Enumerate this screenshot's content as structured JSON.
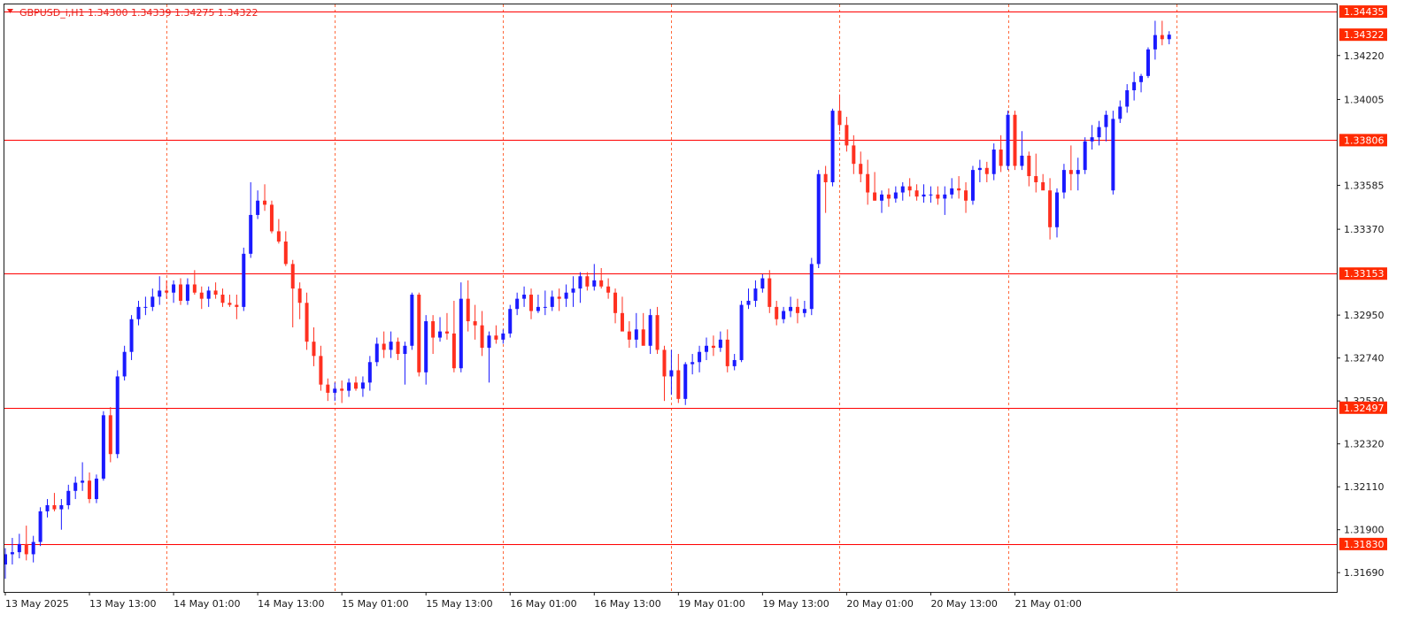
{
  "header": {
    "symbol": "GBPUSD_i",
    "timeframe": "H1",
    "open": "1.34300",
    "high": "1.34339",
    "low": "1.34275",
    "close": "1.34322",
    "label": "GBPUSD_i,H1  1.34300 1.34339 1.34275 1.34322"
  },
  "colors": {
    "bull": "#1a1aff",
    "bear": "#ff3020",
    "level_line": "#ff0000",
    "grid": "#ff6a3d",
    "axis": "#1a1a1a",
    "tag_bg": "#ff2a00",
    "background": "#ffffff"
  },
  "chart_data": {
    "type": "candlestick",
    "ylim": [
      1.316,
      1.3447
    ],
    "y_ticks": [
      "1.34220",
      "1.34005",
      "1.33585",
      "1.33370",
      "1.32950",
      "1.32740",
      "1.32530",
      "1.32320",
      "1.32110",
      "1.31900",
      "1.31690"
    ],
    "x_ticks": [
      "13 May 2025",
      "13 May 13:00",
      "14 May 01:00",
      "14 May 13:00",
      "15 May 01:00",
      "15 May 13:00",
      "16 May 01:00",
      "16 May 13:00",
      "19 May 01:00",
      "19 May 13:00",
      "20 May 01:00",
      "20 May 13:00",
      "21 May 01:00"
    ],
    "x_tick_index": [
      0,
      12,
      24,
      36,
      48,
      60,
      72,
      84,
      96,
      108,
      120,
      132,
      144
    ],
    "vertical_grid_index": [
      23,
      47,
      71,
      95,
      119,
      143,
      167
    ],
    "grid_labels": "off",
    "price_levels": [
      "1.34435",
      "1.33806",
      "1.33153",
      "1.32497",
      "1.31830"
    ],
    "current_price": "1.34322",
    "candles": [
      [
        1.3173,
        1.3181,
        1.3166,
        1.3178
      ],
      [
        1.3178,
        1.3186,
        1.3173,
        1.3179
      ],
      [
        1.3179,
        1.3188,
        1.3176,
        1.3183
      ],
      [
        1.3183,
        1.3192,
        1.3175,
        1.3178
      ],
      [
        1.3178,
        1.3187,
        1.3174,
        1.3184
      ],
      [
        1.3184,
        1.3201,
        1.3182,
        1.3199
      ],
      [
        1.3199,
        1.3205,
        1.3196,
        1.3202
      ],
      [
        1.3202,
        1.3208,
        1.3199,
        1.32
      ],
      [
        1.32,
        1.3205,
        1.319,
        1.3202
      ],
      [
        1.3202,
        1.3212,
        1.32,
        1.3209
      ],
      [
        1.3209,
        1.3216,
        1.3205,
        1.3213
      ],
      [
        1.3213,
        1.3223,
        1.3209,
        1.3214
      ],
      [
        1.3214,
        1.3218,
        1.3203,
        1.3205
      ],
      [
        1.3205,
        1.3217,
        1.3203,
        1.3215
      ],
      [
        1.3215,
        1.3248,
        1.3214,
        1.3246
      ],
      [
        1.3246,
        1.325,
        1.3223,
        1.3227
      ],
      [
        1.3227,
        1.3268,
        1.3225,
        1.3265
      ],
      [
        1.3265,
        1.328,
        1.3263,
        1.3277
      ],
      [
        1.3277,
        1.3295,
        1.3273,
        1.3293
      ],
      [
        1.3293,
        1.3302,
        1.329,
        1.3299
      ],
      [
        1.3299,
        1.3304,
        1.3295,
        1.3299
      ],
      [
        1.3299,
        1.3308,
        1.3297,
        1.3304
      ],
      [
        1.3304,
        1.3314,
        1.33,
        1.3307
      ],
      [
        1.3307,
        1.3312,
        1.3303,
        1.3306
      ],
      [
        1.3306,
        1.3312,
        1.3301,
        1.331
      ],
      [
        1.331,
        1.3313,
        1.33,
        1.3302
      ],
      [
        1.3302,
        1.3313,
        1.33,
        1.331
      ],
      [
        1.331,
        1.3317,
        1.3305,
        1.3306
      ],
      [
        1.3306,
        1.3309,
        1.3298,
        1.3303
      ],
      [
        1.3303,
        1.3309,
        1.3299,
        1.3307
      ],
      [
        1.3307,
        1.3311,
        1.3303,
        1.3305
      ],
      [
        1.3305,
        1.3308,
        1.3299,
        1.3301
      ],
      [
        1.3301,
        1.3305,
        1.3299,
        1.33
      ],
      [
        1.33,
        1.3305,
        1.3293,
        1.3299
      ],
      [
        1.3299,
        1.3328,
        1.3297,
        1.3325
      ],
      [
        1.3325,
        1.336,
        1.3323,
        1.3344
      ],
      [
        1.3344,
        1.3356,
        1.3342,
        1.3351
      ],
      [
        1.3351,
        1.3359,
        1.3346,
        1.3349
      ],
      [
        1.3349,
        1.3351,
        1.3335,
        1.3336
      ],
      [
        1.3336,
        1.3342,
        1.333,
        1.3331
      ],
      [
        1.3331,
        1.3336,
        1.3319,
        1.332
      ],
      [
        1.332,
        1.3322,
        1.3289,
        1.3308
      ],
      [
        1.3308,
        1.3311,
        1.3293,
        1.3301
      ],
      [
        1.3301,
        1.3306,
        1.3278,
        1.3282
      ],
      [
        1.3282,
        1.3289,
        1.327,
        1.3275
      ],
      [
        1.3275,
        1.328,
        1.3258,
        1.3261
      ],
      [
        1.3261,
        1.3264,
        1.3253,
        1.3257
      ],
      [
        1.3257,
        1.3262,
        1.3253,
        1.3259
      ],
      [
        1.3259,
        1.3263,
        1.3252,
        1.3258
      ],
      [
        1.3258,
        1.3264,
        1.3255,
        1.3262
      ],
      [
        1.3262,
        1.3265,
        1.3258,
        1.3259
      ],
      [
        1.3259,
        1.3265,
        1.3255,
        1.3262
      ],
      [
        1.3262,
        1.3275,
        1.3258,
        1.3272
      ],
      [
        1.3272,
        1.3284,
        1.327,
        1.3281
      ],
      [
        1.3281,
        1.3287,
        1.3274,
        1.3278
      ],
      [
        1.3278,
        1.3287,
        1.3274,
        1.3282
      ],
      [
        1.3282,
        1.3284,
        1.3273,
        1.3276
      ],
      [
        1.3276,
        1.3282,
        1.3261,
        1.328
      ],
      [
        1.328,
        1.3306,
        1.3278,
        1.3305
      ],
      [
        1.3305,
        1.3306,
        1.3265,
        1.3267
      ],
      [
        1.3267,
        1.3295,
        1.3261,
        1.3292
      ],
      [
        1.3292,
        1.3295,
        1.3276,
        1.3284
      ],
      [
        1.3284,
        1.3294,
        1.3282,
        1.3287
      ],
      [
        1.3287,
        1.3296,
        1.3283,
        1.3286
      ],
      [
        1.3286,
        1.3302,
        1.3267,
        1.3269
      ],
      [
        1.3269,
        1.3311,
        1.3267,
        1.3303
      ],
      [
        1.3303,
        1.3312,
        1.3287,
        1.3292
      ],
      [
        1.3292,
        1.33,
        1.3283,
        1.329
      ],
      [
        1.329,
        1.3297,
        1.3275,
        1.3279
      ],
      [
        1.3279,
        1.3287,
        1.3262,
        1.3285
      ],
      [
        1.3285,
        1.329,
        1.3281,
        1.3283
      ],
      [
        1.3283,
        1.3288,
        1.3281,
        1.3286
      ],
      [
        1.3286,
        1.33,
        1.3284,
        1.3298
      ],
      [
        1.3298,
        1.3306,
        1.3295,
        1.3303
      ],
      [
        1.3303,
        1.3309,
        1.3299,
        1.3305
      ],
      [
        1.3305,
        1.3308,
        1.3293,
        1.3297
      ],
      [
        1.3297,
        1.3305,
        1.3296,
        1.3299
      ],
      [
        1.3299,
        1.3307,
        1.3295,
        1.3299
      ],
      [
        1.3299,
        1.3307,
        1.3297,
        1.3304
      ],
      [
        1.3304,
        1.3308,
        1.3297,
        1.3303
      ],
      [
        1.3303,
        1.331,
        1.3299,
        1.3306
      ],
      [
        1.3306,
        1.3314,
        1.3299,
        1.3308
      ],
      [
        1.3308,
        1.3316,
        1.3301,
        1.3314
      ],
      [
        1.3314,
        1.3316,
        1.3307,
        1.3309
      ],
      [
        1.3309,
        1.332,
        1.3307,
        1.3312
      ],
      [
        1.3312,
        1.3318,
        1.3308,
        1.3309
      ],
      [
        1.3309,
        1.3313,
        1.3303,
        1.3306
      ],
      [
        1.3306,
        1.3308,
        1.3291,
        1.3296
      ],
      [
        1.3296,
        1.3304,
        1.3289,
        1.3287
      ],
      [
        1.3287,
        1.3292,
        1.3279,
        1.3283
      ],
      [
        1.3283,
        1.3296,
        1.3279,
        1.3288
      ],
      [
        1.3288,
        1.3296,
        1.3282,
        1.328
      ],
      [
        1.328,
        1.3298,
        1.3276,
        1.3295
      ],
      [
        1.3295,
        1.3299,
        1.3276,
        1.3278
      ],
      [
        1.3278,
        1.328,
        1.3253,
        1.3265
      ],
      [
        1.3265,
        1.3278,
        1.3256,
        1.3268
      ],
      [
        1.3268,
        1.3276,
        1.3252,
        1.3254
      ],
      [
        1.3254,
        1.3272,
        1.3251,
        1.3271
      ],
      [
        1.3271,
        1.3276,
        1.3266,
        1.3272
      ],
      [
        1.3272,
        1.328,
        1.3267,
        1.3277
      ],
      [
        1.3277,
        1.3284,
        1.3273,
        1.328
      ],
      [
        1.328,
        1.3285,
        1.3275,
        1.3279
      ],
      [
        1.3279,
        1.3287,
        1.3277,
        1.3283
      ],
      [
        1.3283,
        1.3288,
        1.3267,
        1.327
      ],
      [
        1.327,
        1.3276,
        1.3268,
        1.3273
      ],
      [
        1.3273,
        1.3302,
        1.3272,
        1.33
      ],
      [
        1.33,
        1.3308,
        1.3298,
        1.3302
      ],
      [
        1.3302,
        1.3312,
        1.3299,
        1.3308
      ],
      [
        1.3308,
        1.3315,
        1.3306,
        1.3313
      ],
      [
        1.3313,
        1.3317,
        1.3296,
        1.3299
      ],
      [
        1.3299,
        1.3302,
        1.329,
        1.3293
      ],
      [
        1.3293,
        1.3299,
        1.3291,
        1.3297
      ],
      [
        1.3297,
        1.3304,
        1.3294,
        1.3299
      ],
      [
        1.3299,
        1.3303,
        1.3291,
        1.3296
      ],
      [
        1.3296,
        1.3302,
        1.3294,
        1.3298
      ],
      [
        1.3298,
        1.3323,
        1.3295,
        1.332
      ],
      [
        1.332,
        1.3366,
        1.3318,
        1.3364
      ],
      [
        1.3364,
        1.3368,
        1.3345,
        1.336
      ],
      [
        1.336,
        1.3396,
        1.3358,
        1.3395
      ],
      [
        1.3395,
        1.3403,
        1.3385,
        1.3388
      ],
      [
        1.3388,
        1.3392,
        1.3375,
        1.3378
      ],
      [
        1.3378,
        1.3383,
        1.3364,
        1.3369
      ],
      [
        1.3369,
        1.3375,
        1.336,
        1.3364
      ],
      [
        1.3364,
        1.3371,
        1.3349,
        1.3355
      ],
      [
        1.3355,
        1.3365,
        1.3351,
        1.3351
      ],
      [
        1.3351,
        1.3356,
        1.3345,
        1.3354
      ],
      [
        1.3354,
        1.3357,
        1.3348,
        1.3352
      ],
      [
        1.3352,
        1.3358,
        1.335,
        1.3355
      ],
      [
        1.3355,
        1.336,
        1.3351,
        1.3358
      ],
      [
        1.3358,
        1.3362,
        1.3353,
        1.3356
      ],
      [
        1.3356,
        1.3359,
        1.3351,
        1.3353
      ],
      [
        1.3353,
        1.3359,
        1.335,
        1.3354
      ],
      [
        1.3354,
        1.3358,
        1.335,
        1.3354
      ],
      [
        1.3354,
        1.3358,
        1.3349,
        1.3352
      ],
      [
        1.3352,
        1.3358,
        1.3344,
        1.3354
      ],
      [
        1.3354,
        1.3362,
        1.3352,
        1.3357
      ],
      [
        1.3357,
        1.3363,
        1.3352,
        1.3356
      ],
      [
        1.3356,
        1.336,
        1.3345,
        1.3351
      ],
      [
        1.3351,
        1.3368,
        1.3349,
        1.3366
      ],
      [
        1.3366,
        1.3371,
        1.336,
        1.3367
      ],
      [
        1.3367,
        1.337,
        1.336,
        1.3364
      ],
      [
        1.3364,
        1.3379,
        1.3361,
        1.3376
      ],
      [
        1.3376,
        1.3383,
        1.3365,
        1.3368
      ],
      [
        1.3368,
        1.3395,
        1.3366,
        1.3393
      ],
      [
        1.3393,
        1.3395,
        1.3366,
        1.3368
      ],
      [
        1.3368,
        1.3385,
        1.3366,
        1.3373
      ],
      [
        1.3373,
        1.3375,
        1.3358,
        1.3363
      ],
      [
        1.3363,
        1.3374,
        1.3355,
        1.336
      ],
      [
        1.336,
        1.3364,
        1.3358,
        1.3356
      ],
      [
        1.3356,
        1.3362,
        1.3332,
        1.3338
      ],
      [
        1.3338,
        1.3357,
        1.3333,
        1.3355
      ],
      [
        1.3355,
        1.3369,
        1.3352,
        1.3366
      ],
      [
        1.3366,
        1.3378,
        1.3356,
        1.3364
      ],
      [
        1.3364,
        1.3372,
        1.3356,
        1.3366
      ],
      [
        1.3366,
        1.3382,
        1.3364,
        1.338
      ],
      [
        1.338,
        1.3388,
        1.3376,
        1.3382
      ],
      [
        1.3382,
        1.339,
        1.3378,
        1.3387
      ],
      [
        1.3387,
        1.3395,
        1.338,
        1.3393
      ],
      [
        1.3356,
        1.3395,
        1.3354,
        1.3391
      ],
      [
        1.3391,
        1.34,
        1.3389,
        1.3397
      ],
      [
        1.3397,
        1.3408,
        1.3394,
        1.3405
      ],
      [
        1.3405,
        1.3414,
        1.34,
        1.3409
      ],
      [
        1.3409,
        1.3413,
        1.3404,
        1.3412
      ],
      [
        1.3412,
        1.3426,
        1.3411,
        1.3425
      ],
      [
        1.3425,
        1.3439,
        1.342,
        1.3432
      ],
      [
        1.3432,
        1.3439,
        1.3427,
        1.343
      ],
      [
        1.343,
        1.34339,
        1.34275,
        1.34322
      ]
    ]
  }
}
